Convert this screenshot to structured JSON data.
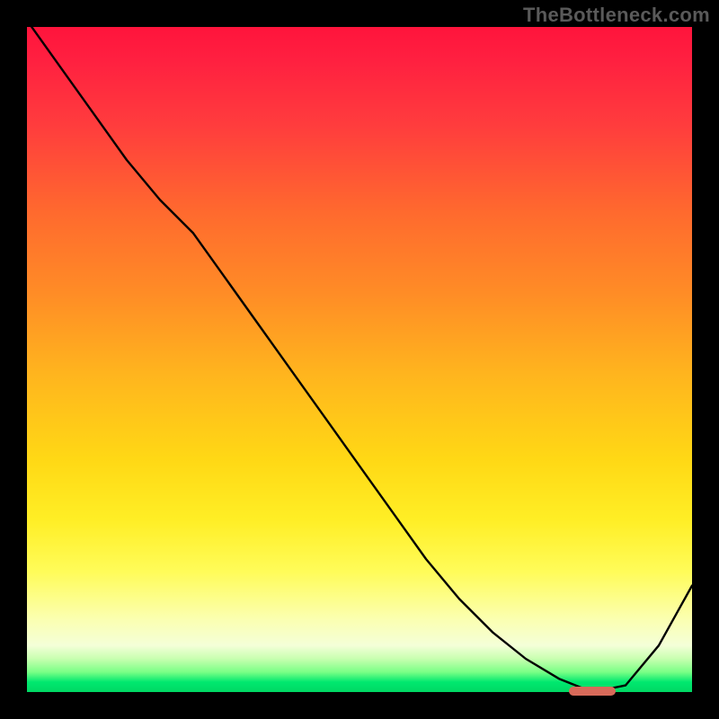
{
  "attribution": "TheBottleneck.com",
  "chart_data": {
    "type": "line",
    "x": [
      0.0,
      0.05,
      0.1,
      0.15,
      0.2,
      0.25,
      0.3,
      0.35,
      0.4,
      0.45,
      0.5,
      0.55,
      0.6,
      0.65,
      0.7,
      0.75,
      0.8,
      0.85,
      0.9,
      0.95,
      1.0
    ],
    "values": [
      1.01,
      0.94,
      0.87,
      0.8,
      0.74,
      0.69,
      0.62,
      0.55,
      0.48,
      0.41,
      0.34,
      0.27,
      0.2,
      0.14,
      0.09,
      0.05,
      0.02,
      0.0,
      0.01,
      0.07,
      0.16
    ],
    "title": "",
    "xlabel": "",
    "ylabel": "",
    "xlim": [
      0,
      1
    ],
    "ylim": [
      0,
      1
    ],
    "marker": {
      "x": 0.85,
      "y": 0.002
    },
    "background_gradient": {
      "stops": [
        {
          "pos": 0.0,
          "color": "#ff143c"
        },
        {
          "pos": 0.4,
          "color": "#ff8c26"
        },
        {
          "pos": 0.74,
          "color": "#ffee25"
        },
        {
          "pos": 0.97,
          "color": "#7aff86"
        },
        {
          "pos": 1.0,
          "color": "#00d864"
        }
      ]
    }
  }
}
